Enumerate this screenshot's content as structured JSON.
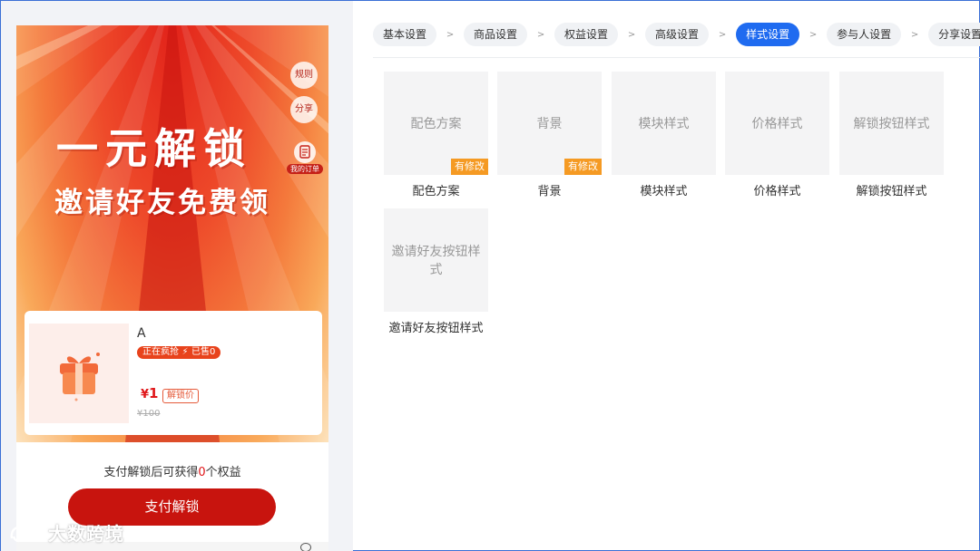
{
  "preview": {
    "rules_label": "规则",
    "share_label": "分享",
    "my_orders_label": "我的订单",
    "title_main": "一元解锁",
    "title_sub": "邀请好友免费领",
    "product": {
      "name": "A",
      "hot_label": "正在疯抢",
      "sold_label": "已售0",
      "price_symbol": "¥",
      "price": "1",
      "unlock_price_label": "解锁价",
      "original_price": "¥100"
    },
    "benefit_prefix": "支付解锁后可获得",
    "benefit_count": "0",
    "benefit_suffix": "个权益",
    "pay_button": "支付解锁"
  },
  "watermark": "大数跨境",
  "steps": [
    {
      "label": "基本设置",
      "active": false
    },
    {
      "label": "商品设置",
      "active": false
    },
    {
      "label": "权益设置",
      "active": false
    },
    {
      "label": "高级设置",
      "active": false
    },
    {
      "label": "样式设置",
      "active": true
    },
    {
      "label": "参与人设置",
      "active": false
    },
    {
      "label": "分享设置",
      "active": false
    }
  ],
  "step_separator": ">",
  "tiles": [
    {
      "box_text": "配色方案",
      "caption": "配色方案",
      "badge": "有修改"
    },
    {
      "box_text": "背景",
      "caption": "背景",
      "badge": "有修改"
    },
    {
      "box_text": "模块样式",
      "caption": "模块样式",
      "badge": ""
    },
    {
      "box_text": "价格样式",
      "caption": "价格样式",
      "badge": ""
    },
    {
      "box_text": "解锁按钮样式",
      "caption": "解锁按钮样式",
      "badge": ""
    },
    {
      "box_text": "邀请好友按钮样式",
      "caption": "邀请好友按钮样式",
      "badge": ""
    }
  ],
  "colors": {
    "accent_blue": "#1f6bf0",
    "pay_button_red": "#c8140e",
    "badge_orange": "#f59a23",
    "price_red": "#e0171a"
  }
}
